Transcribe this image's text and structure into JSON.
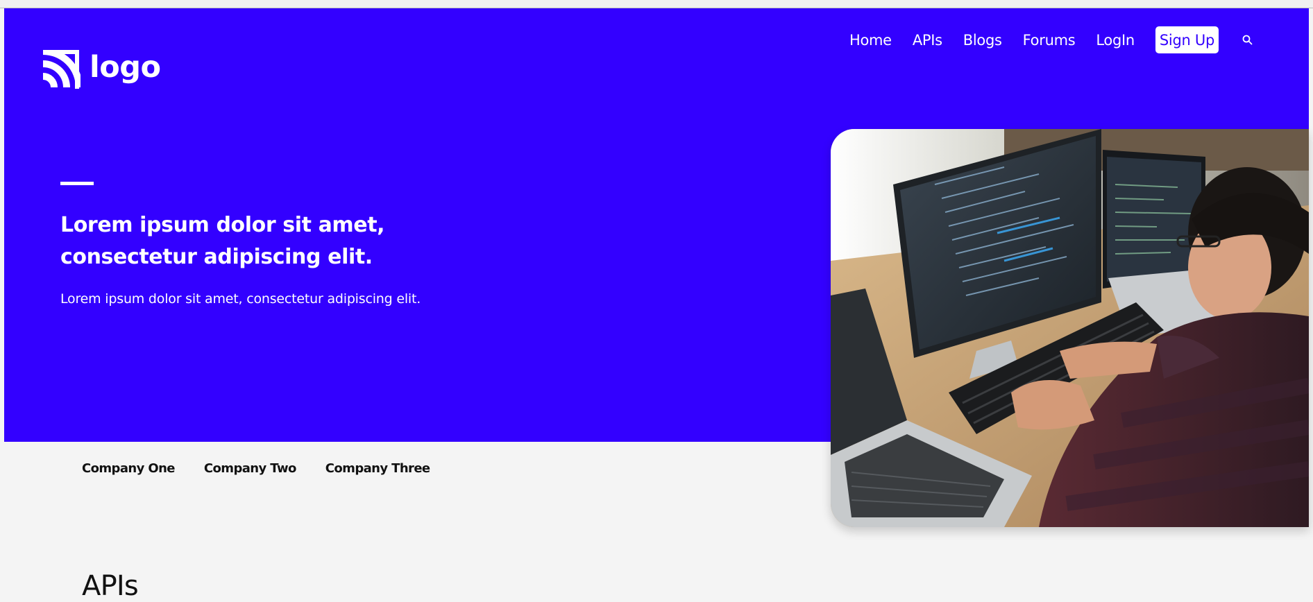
{
  "brand": {
    "logo_text": "logo",
    "icon": "logo-mark-icon",
    "hero_color": "#3300ff"
  },
  "nav": {
    "items": [
      {
        "label": "Home"
      },
      {
        "label": "APIs"
      },
      {
        "label": "Blogs"
      },
      {
        "label": "Forums"
      },
      {
        "label": "LogIn"
      }
    ],
    "signup_label": "Sign Up",
    "search_icon": "search-icon"
  },
  "hero": {
    "headline": "Lorem ipsum dolor sit amet, consectetur adipiscing elit.",
    "subheadline": "Lorem ipsum dolor sit amet, consectetur adipiscing elit."
  },
  "companies": [
    "Company One",
    "Company Two",
    "Company Three"
  ],
  "section": {
    "title": "APIs"
  }
}
